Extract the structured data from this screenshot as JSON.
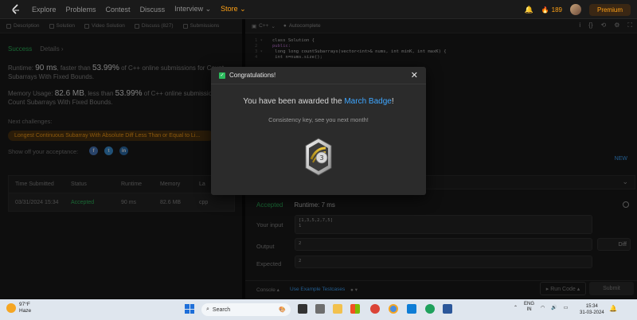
{
  "nav": {
    "items": [
      {
        "label": "Explore"
      },
      {
        "label": "Problems"
      },
      {
        "label": "Contest"
      },
      {
        "label": "Discuss"
      },
      {
        "label": "Interview ⌄"
      },
      {
        "label": "Store ⌄"
      }
    ],
    "streak": "189",
    "premium": "Premium"
  },
  "left": {
    "tabs": [
      "Description",
      "Solution",
      "Video Solution",
      "Discuss (827)",
      "Submissions"
    ],
    "success": "Success",
    "details": "Details ›",
    "runtime_pre": "Runtime: ",
    "runtime_val": "90 ms",
    "runtime_mid": ", faster than ",
    "runtime_pct": "53.99%",
    "runtime_post": " of C++ online submissions for Count Subarrays With Fixed Bounds.",
    "memory_pre": "Memory Usage: ",
    "memory_val": "82.6 MB",
    "memory_mid": ", less than ",
    "memory_pct": "53.99%",
    "memory_post": " of C++ online submissions for Count Subarrays With Fixed Bounds.",
    "next_label": "Next challenges:",
    "challenge": "Longest Continuous Subarray With Absolute Diff Less Than or Equal to Li...",
    "show_off": "Show off your acceptance:",
    "social": [
      "f",
      "t",
      "in"
    ],
    "table": {
      "headers": [
        "Time Submitted",
        "Status",
        "Runtime",
        "Memory",
        "La"
      ],
      "rows": [
        [
          "03/31/2024 15:34",
          "Accepted",
          "90 ms",
          "82.6 MB",
          "cpp"
        ]
      ]
    }
  },
  "right": {
    "lang": "C++",
    "autocomplete": "Autocomplete",
    "tools": [
      "i",
      "{}",
      "⟲",
      "⚙",
      "⛶"
    ],
    "code": [
      {
        "n": "1 ▾",
        "t": "class Solution {"
      },
      {
        "n": "2",
        "t": "public:"
      },
      {
        "n": "3 ▾",
        "t": "    long long countSubarrays(vector<int>& nums, int minK, int maxK) {"
      },
      {
        "n": "4",
        "t": "        int n=nums.size();"
      }
    ],
    "new_link": "NEW",
    "result_status": "Accepted",
    "result_runtime": "Runtime: 7 ms",
    "input_label": "Your input",
    "input_val1": "[1,3,5,2,7,5]",
    "input_val2": "1",
    "output_label": "Output",
    "output_val": "2",
    "expected_label": "Expected",
    "expected_val": "2",
    "diff": "Diff",
    "console": "Console ▴",
    "example": "Use Example Testcases",
    "run_code": "▸ Run Code ▴",
    "submit": "Submit"
  },
  "modal": {
    "title": "Congratulations!",
    "award_pre": "You have been awarded the ",
    "award_name": "March Badge",
    "award_post": "!",
    "consistency": "Consistency key, see you next month!",
    "badge_label": "3"
  },
  "taskbar": {
    "temp": "97°F",
    "cond": "Haze",
    "search": "Search",
    "lang1": "ENG",
    "lang2": "IN",
    "time": "15:34",
    "date": "31-03-2024"
  }
}
